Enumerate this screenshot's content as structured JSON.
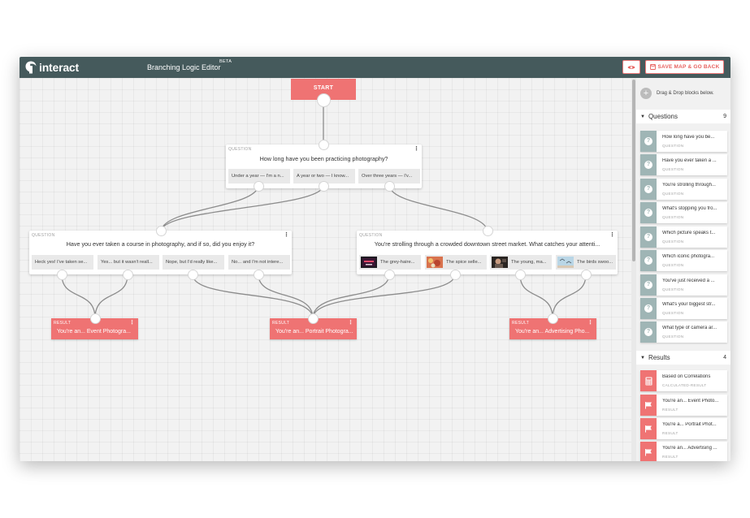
{
  "app": {
    "name": "interact",
    "editor_title": "Branching Logic Editor",
    "beta_label": "BETA"
  },
  "toolbar": {
    "save_label": "SAVE MAP & GO BACK",
    "preview_icon": "eye-icon"
  },
  "canvas": {
    "start_label": "START",
    "q1": {
      "type_label": "QUESTION",
      "text": "How long have you been practicing photography?",
      "answers": [
        "Under a year — I'm a n...",
        "A year or two — I know...",
        "Over three years — I'v..."
      ]
    },
    "q2": {
      "type_label": "QUESTION",
      "text": "Have you ever taken a course in photography, and if so, did you enjoy it?",
      "answers": [
        "Heck yes! I've taken se...",
        "Yes... but it wasn't reall...",
        "Nope, but I'd really like...",
        "No... and I'm not intere..."
      ]
    },
    "q3": {
      "type_label": "QUESTION",
      "text": "You're strolling through a crowded downtown street market. What catches your attenti...",
      "answers": [
        "The grey-haire...",
        "The spice selle...",
        "The young, ma...",
        "The birds swoo..."
      ]
    },
    "results": [
      {
        "type_label": "RESULT",
        "text": "You're an... Event Photogra..."
      },
      {
        "type_label": "RESULT",
        "text": "You're an... Portrait Photogra..."
      },
      {
        "type_label": "RESULT",
        "text": "You're an... Advertising Pho..."
      }
    ]
  },
  "sidebar": {
    "hint": "Drag & Drop blocks below.",
    "questions_label": "Questions",
    "questions_count": "9",
    "questions": [
      {
        "title": "How long have you be...",
        "sub": "QUESTION"
      },
      {
        "title": "Have you ever taken a ...",
        "sub": "QUESTION"
      },
      {
        "title": "You're strolling through...",
        "sub": "QUESTION"
      },
      {
        "title": "What's stopping you fro...",
        "sub": "QUESTION"
      },
      {
        "title": "Which picture speaks t...",
        "sub": "QUESTION"
      },
      {
        "title": "Which iconic photogra...",
        "sub": "QUESTION"
      },
      {
        "title": "You've just received a ...",
        "sub": "QUESTION"
      },
      {
        "title": "What's your biggest str...",
        "sub": "QUESTION"
      },
      {
        "title": "What type of camera ar...",
        "sub": "QUESTION"
      }
    ],
    "results_label": "Results",
    "results_count": "4",
    "results": [
      {
        "title": "Based on Correlations",
        "sub": "CALCULATED-RESULT",
        "icon": "calculator-icon"
      },
      {
        "title": "You're an... Event Photo...",
        "sub": "RESULT",
        "icon": "flag-icon"
      },
      {
        "title": "You're a... Portrait Phot...",
        "sub": "RESULT",
        "icon": "flag-icon"
      },
      {
        "title": "You're an... Advertising ...",
        "sub": "RESULT",
        "icon": "flag-icon"
      }
    ]
  },
  "colors": {
    "topbar": "#455a5c",
    "accent": "#ef7373",
    "question_icon": "#9fb5b5"
  }
}
